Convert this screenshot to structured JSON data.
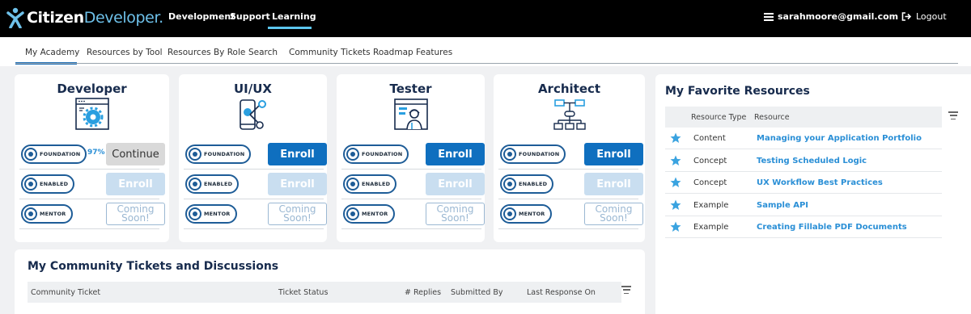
{
  "brand": {
    "word1": "Citizen",
    "word2": "Developer.",
    "accent": "#6ec1ea"
  },
  "topnav": [
    "Development",
    "Support",
    "Learning"
  ],
  "active_topnav": "Learning",
  "user": {
    "email": "sarahmoore@gmail.com",
    "menu_icon": "hamburger-icon"
  },
  "logout": {
    "label": "Logout",
    "icon": "logout-icon"
  },
  "subtabs": [
    "My Academy",
    "Resources by Tool",
    "Resources By Role",
    "Search",
    "Community Tickets",
    "Roadmap Features"
  ],
  "active_subtab": "My Academy",
  "roles": [
    {
      "title": "Developer",
      "icon": "developer-gear-icon",
      "rows": [
        {
          "badge": "FOUNDATION",
          "action": "Continue",
          "state": "continue",
          "progress": "97%"
        },
        {
          "badge": "ENABLED",
          "action": "Enroll",
          "state": "disabled"
        },
        {
          "badge": "MENTOR",
          "action": "Coming Soon!",
          "state": "soon"
        }
      ]
    },
    {
      "title": "UI/UX",
      "icon": "uiux-touch-icon",
      "rows": [
        {
          "badge": "FOUNDATION",
          "action": "Enroll",
          "state": "enroll"
        },
        {
          "badge": "ENABLED",
          "action": "Enroll",
          "state": "disabled"
        },
        {
          "badge": "MENTOR",
          "action": "Coming Soon!",
          "state": "soon"
        }
      ]
    },
    {
      "title": "Tester",
      "icon": "tester-person-icon",
      "rows": [
        {
          "badge": "FOUNDATION",
          "action": "Enroll",
          "state": "enroll"
        },
        {
          "badge": "ENABLED",
          "action": "Enroll",
          "state": "disabled"
        },
        {
          "badge": "MENTOR",
          "action": "Coming Soon!",
          "state": "soon"
        }
      ]
    },
    {
      "title": "Architect",
      "icon": "architect-diagram-icon",
      "rows": [
        {
          "badge": "FOUNDATION",
          "action": "Enroll",
          "state": "enroll"
        },
        {
          "badge": "ENABLED",
          "action": "Enroll",
          "state": "disabled"
        },
        {
          "badge": "MENTOR",
          "action": "Coming Soon!",
          "state": "soon"
        }
      ]
    }
  ],
  "favorites": {
    "title": "My Favorite Resources",
    "columns": [
      "Resource Type",
      "Resource"
    ],
    "rows": [
      {
        "type": "Content",
        "resource": "Managing your Application Portfolio"
      },
      {
        "type": "Concept",
        "resource": "Testing Scheduled Logic"
      },
      {
        "type": "Concept",
        "resource": "UX Workflow Best Practices"
      },
      {
        "type": "Example",
        "resource": "Sample API"
      },
      {
        "type": "Example",
        "resource": "Creating Fillable PDF Documents"
      }
    ]
  },
  "tickets": {
    "title": "My Community Tickets and Discussions",
    "columns": [
      "Community Ticket",
      "Ticket Status",
      "# Replies",
      "Submitted By",
      "Last Response On"
    ]
  },
  "colors": {
    "primary": "#0f6fbf",
    "heading": "#172b4d",
    "link": "#2a8fd6"
  }
}
